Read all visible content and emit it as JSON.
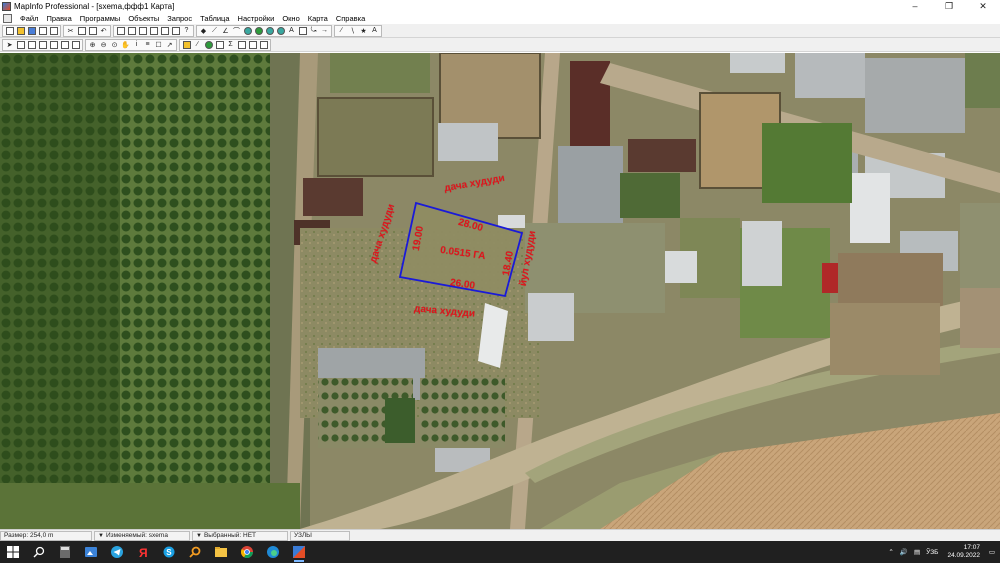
{
  "window": {
    "title": "MapInfo Professional - [sxema,ффф1 Карта]"
  },
  "menu": {
    "items": [
      "Файл",
      "Правка",
      "Программы",
      "Объекты",
      "Запрос",
      "Таблица",
      "Настройки",
      "Окно",
      "Карта",
      "Справка"
    ]
  },
  "toolbar1": {
    "icons": [
      "new-icon",
      "open-icon",
      "save-icon",
      "save-workspace-icon",
      "print-icon",
      "cut-icon",
      "copy-icon",
      "paste-icon",
      "undo-icon",
      "new-browser-icon",
      "new-mapper-icon",
      "new-grapher-icon",
      "new-layout-icon",
      "redistrict-icon",
      "legend-icon",
      "help-icon",
      "symbol-icon",
      "line-icon",
      "polyline-icon",
      "arc-icon",
      "polygon-icon",
      "ellipse-icon",
      "rectangle-icon",
      "rounded-rect-icon",
      "text-icon",
      "frame-icon",
      "reshape-icon",
      "add-node-icon",
      "line-style-icon",
      "region-style-icon",
      "symbol-style-icon",
      "text-style-icon"
    ]
  },
  "toolbar2": {
    "icons": [
      "select-icon",
      "marquee-select-icon",
      "radius-select-icon",
      "polygon-select-icon",
      "boundary-select-icon",
      "unselect-icon",
      "invert-select-icon",
      "zoom-in-icon",
      "zoom-out-icon",
      "change-view-icon",
      "grabber-icon",
      "info-icon",
      "label-icon",
      "drag-window-icon",
      "hotlink-icon",
      "layer-control-icon",
      "ruler-icon",
      "statistics-icon",
      "legend-window-icon",
      "thematic-icon",
      "options-icon",
      "clip-region-icon",
      "region-icon"
    ]
  },
  "map": {
    "labels": {
      "area": "0.0515 ГА",
      "top_dim": "28.00",
      "bottom_dim": "26.00",
      "left_dim": "19.00",
      "right_dim": "18.40",
      "north_neighbor": "дача худуди",
      "west_neighbor": "дача худуди",
      "south_neighbor": "дача худуди",
      "east_road": "йул худуди"
    },
    "colors": {
      "plot_outline": "#1a1ad8",
      "label": "#e0141c"
    }
  },
  "statusbar": {
    "size": "Размер: 254,0 m",
    "editable": "Изменяемый: sxema",
    "selected": "Выбранный: НЕТ",
    "snap": "УЗЛЫ"
  },
  "taskbar": {
    "apps": [
      "start-icon",
      "search-icon",
      "calculator-icon",
      "photos-icon",
      "telegram-icon",
      "yandex-icon",
      "skype-icon",
      "search-app-icon",
      "folder-icon",
      "chrome-icon",
      "edge-icon",
      "mapinfo-icon"
    ],
    "tray": {
      "lang": "ЎЗБ",
      "time": "17:07",
      "date": "24.09.2022"
    }
  }
}
